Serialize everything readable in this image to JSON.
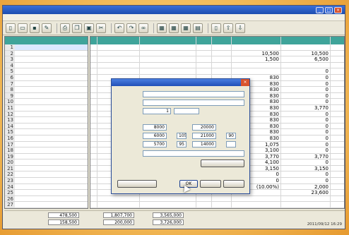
{
  "window": {
    "title": ""
  },
  "menu": [
    "",
    "",
    "",
    "",
    "",
    "",
    "",
    "",
    ""
  ],
  "toolbar": {
    "icons": [
      "new-icon",
      "open-icon",
      "save-icon",
      "edit-icon",
      "print-icon",
      "copy-icon",
      "paste-icon",
      "cut-icon",
      "undo-icon",
      "redo-icon",
      "link-icon",
      "tool-a-icon",
      "tool-b-icon",
      "tool-c-icon",
      "tool-d-icon",
      "export-icon",
      "up-icon",
      "down-icon"
    ]
  },
  "tree": {
    "items": [
      {
        "num": "1",
        "label": ""
      },
      {
        "num": "2",
        "label": ""
      },
      {
        "num": "3",
        "label": ""
      },
      {
        "num": "4",
        "label": ""
      },
      {
        "num": "5",
        "label": ""
      },
      {
        "num": "6",
        "label": ""
      },
      {
        "num": "7",
        "label": ""
      },
      {
        "num": "8",
        "label": ""
      },
      {
        "num": "9",
        "label": ""
      },
      {
        "num": "10",
        "label": ""
      },
      {
        "num": "11",
        "label": ""
      },
      {
        "num": "12",
        "label": ""
      },
      {
        "num": "13",
        "label": ""
      },
      {
        "num": "14",
        "label": ""
      },
      {
        "num": "15",
        "label": ""
      },
      {
        "num": "16",
        "label": ""
      },
      {
        "num": "17",
        "label": ""
      },
      {
        "num": "18",
        "label": ""
      },
      {
        "num": "19",
        "label": ""
      },
      {
        "num": "20",
        "label": ""
      },
      {
        "num": "21",
        "label": ""
      },
      {
        "num": "22",
        "label": ""
      },
      {
        "num": "23",
        "label": ""
      },
      {
        "num": "24",
        "label": ""
      },
      {
        "num": "25",
        "label": ""
      },
      {
        "num": "26",
        "label": ""
      },
      {
        "num": "27",
        "label": ""
      }
    ]
  },
  "table": {
    "columns": [
      "",
      "",
      "",
      "",
      "",
      "",
      ""
    ],
    "rows": [
      [
        "",
        "",
        "",
        "",
        "",
        "",
        ""
      ],
      [
        "",
        "",
        "",
        "",
        "",
        "10,500",
        "10,500"
      ],
      [
        "",
        "",
        "",
        "",
        "",
        "1,500",
        "6,500"
      ],
      [
        "",
        "",
        "",
        "",
        "",
        "",
        ""
      ],
      [
        "",
        "",
        "",
        "",
        "",
        "",
        "0"
      ],
      [
        "",
        "",
        "",
        "",
        "",
        "830",
        "0"
      ],
      [
        "",
        "",
        "",
        "",
        "",
        "830",
        "0"
      ],
      [
        "",
        "",
        "",
        "",
        "",
        "830",
        "0"
      ],
      [
        "",
        "",
        "",
        "",
        "",
        "830",
        "0"
      ],
      [
        "",
        "",
        "",
        "",
        "",
        "830",
        "0"
      ],
      [
        "",
        "",
        "",
        "",
        "",
        "830",
        "3,770"
      ],
      [
        "",
        "",
        "",
        "",
        "",
        "830",
        "0"
      ],
      [
        "",
        "",
        "",
        "",
        "",
        "830",
        "0"
      ],
      [
        "",
        "",
        "",
        "",
        "",
        "830",
        "0"
      ],
      [
        "",
        "",
        "",
        "",
        "",
        "830",
        "0"
      ],
      [
        "",
        "",
        "",
        "",
        "",
        "830",
        "0"
      ],
      [
        "",
        "",
        "",
        "",
        "",
        "1,075",
        "0"
      ],
      [
        "",
        "",
        "",
        "",
        "",
        "3,100",
        "0"
      ],
      [
        "",
        "",
        "",
        "",
        "",
        "3,770",
        "3,770"
      ],
      [
        "",
        "",
        "",
        "",
        "",
        "4,100",
        "0"
      ],
      [
        "",
        "",
        "",
        "",
        "",
        "3,150",
        "3,150"
      ],
      [
        "",
        "",
        "",
        "",
        "",
        "0",
        "0"
      ],
      [
        "",
        "",
        "",
        "",
        "",
        "0",
        "0"
      ],
      [
        "",
        "",
        "",
        "",
        "",
        "(10.00%)",
        "2,000"
      ],
      [
        "",
        "",
        "",
        "",
        "",
        "",
        "23,600"
      ],
      [
        "",
        "",
        "",
        "",
        "",
        "",
        ""
      ],
      [
        "",
        "",
        "",
        "",
        "",
        "",
        ""
      ],
      [
        "",
        "",
        "",
        "",
        "",
        "",
        ""
      ]
    ]
  },
  "status": {
    "label1": "",
    "value1": "478,500",
    "label2": "",
    "value2": "1,807,700",
    "value3": "3,565,000",
    "label4": "",
    "value4": "158,500",
    "value5": "200,000",
    "value6": "3,726,000",
    "clock": "2011/09/12 16:29"
  },
  "dialog": {
    "title": "",
    "name_label": "",
    "name_value": "",
    "spec_label": "",
    "spec_value": "",
    "qty_label": "",
    "qty_value": "1",
    "unit_value": "",
    "col1_header": "",
    "col2_header": "",
    "base_label": "",
    "base_a": "8000",
    "base_b": "20000",
    "rate_label": "",
    "rate_a": "6000",
    "rate_b": "21000",
    "yen": "",
    "pct": "",
    "p1": "105",
    "p2": "90",
    "cost_label": "",
    "cost_a": "5700",
    "cost_b": "14000",
    "p3": "95",
    "p4": "",
    "note_label": "",
    "hint": "",
    "master_button": "",
    "setting_button": "",
    "ok_button": "OK",
    "cancel_button": "",
    "help_button": ""
  }
}
